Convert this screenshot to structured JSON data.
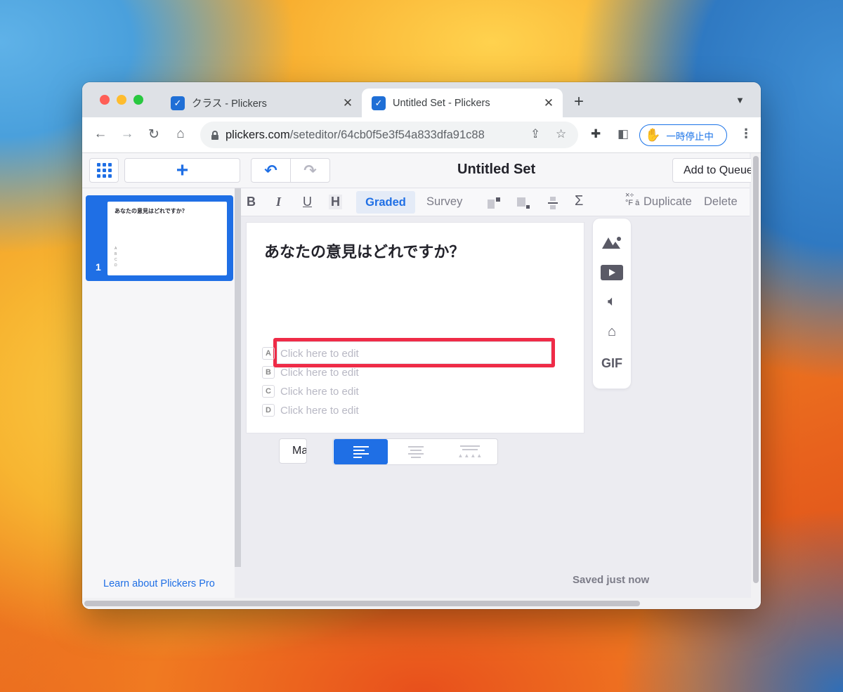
{
  "browser": {
    "tabs": [
      {
        "title": "クラス - Plickers",
        "active": false
      },
      {
        "title": "Untitled Set - Plickers",
        "active": true
      }
    ],
    "new_tab": "+",
    "url_host": "plickers.com",
    "url_path": "/seteditor/64cb0f5e3f54a833dfa91c88",
    "paused_label": "一時停止中"
  },
  "app": {
    "add_label": "+",
    "set_title": "Untitled Set",
    "queue_label": "Add to Queue",
    "sidebar": {
      "slides": [
        {
          "number": "1",
          "question": "あなたの意見はどれですか？",
          "choices": [
            "A",
            "B",
            "C",
            "D"
          ]
        }
      ],
      "learn_link": "Learn about Plickers Pro"
    },
    "format_toolbar": {
      "bold": "B",
      "italic": "I",
      "underline": "U",
      "heading": "H",
      "graded": "Graded",
      "survey": "Survey",
      "sum": "Σ",
      "duplicate": "Duplicate",
      "delete": "Delete"
    },
    "editor": {
      "question": "あなたの意見はどれですか？",
      "choices": [
        {
          "letter": "A",
          "text": "Click here to edit"
        },
        {
          "letter": "B",
          "text": "Click here to edit"
        },
        {
          "letter": "C",
          "text": "Click here to edit"
        },
        {
          "letter": "D",
          "text": "Click here to edit"
        }
      ],
      "math_label": "Ma"
    },
    "media": {
      "gif": "GIF"
    },
    "status": "Saved just now"
  },
  "colors": {
    "accent": "#1f6fe5",
    "highlight": "#ef2b47"
  }
}
